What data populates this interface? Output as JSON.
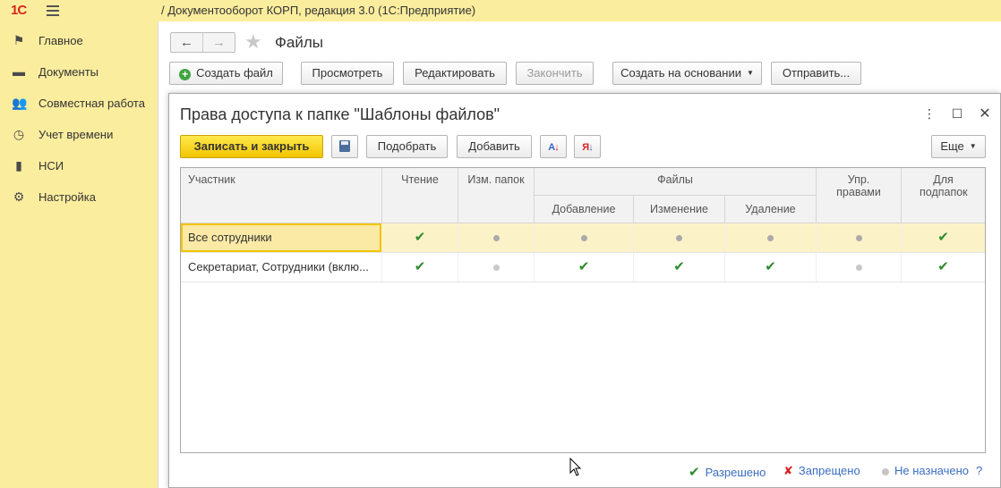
{
  "app": {
    "logo": "1С",
    "title": "/ Документооборот КОРП, редакция 3.0  (1С:Предприятие)"
  },
  "sidebar": {
    "items": [
      {
        "label": "Главное",
        "icon": "flag-icon"
      },
      {
        "label": "Документы",
        "icon": "folder-icon"
      },
      {
        "label": "Совместная работа",
        "icon": "users-icon"
      },
      {
        "label": "Учет времени",
        "icon": "clock-icon"
      },
      {
        "label": "НСИ",
        "icon": "books-icon"
      },
      {
        "label": "Настройка",
        "icon": "gear-icon"
      }
    ]
  },
  "page": {
    "title": "Файлы",
    "toolbar": {
      "create": "Создать файл",
      "view": "Просмотреть",
      "edit": "Редактировать",
      "finish": "Закончить",
      "create_based": "Создать на основании",
      "send": "Отправить..."
    }
  },
  "dialog": {
    "title": "Права доступа к папке \"Шаблоны файлов\"",
    "toolbar": {
      "save_close": "Записать и закрыть",
      "pick": "Подобрать",
      "add": "Добавить",
      "more": "Еще"
    },
    "columns": {
      "participant": "Участник",
      "read": "Чтение",
      "folders": "Изм. папок",
      "files": "Файлы",
      "add": "Добавление",
      "change": "Изменение",
      "delete": "Удаление",
      "rights": "Упр. правами",
      "subfolders": "Для подпапок"
    },
    "rows": [
      {
        "participant": "Все сотрудники",
        "read": "allowed",
        "folders": "unset",
        "add": "unset",
        "change": "unset",
        "delete": "unset",
        "rights": "unset",
        "subfolders": "allowed"
      },
      {
        "participant": "Секретариат, Сотрудники (вклю...",
        "read": "allowed",
        "folders": "unset",
        "add": "allowed",
        "change": "allowed",
        "delete": "allowed",
        "rights": "unset",
        "subfolders": "allowed"
      }
    ],
    "legend": {
      "allowed": "Разрешено",
      "denied": "Запрещено",
      "unset": "Не назначено",
      "help": "?"
    }
  },
  "colors": {
    "sidebar_bg": "#fbed9e",
    "accent": "#f3c300",
    "check": "#2e8b2e",
    "link": "#3a6ec0"
  }
}
